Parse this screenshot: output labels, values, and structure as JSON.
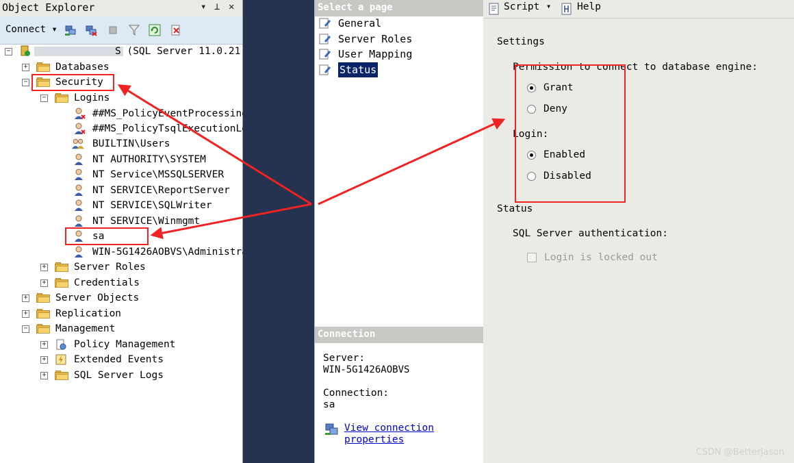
{
  "object_explorer": {
    "title": "Object Explorer",
    "pin": "∇ ↑",
    "close": "✕",
    "toolbar": {
      "connect_label": "Connect ▾"
    },
    "server": {
      "label": "S  (SQL Server 11.0.21"
    },
    "tree": {
      "databases": "Databases",
      "security": "Security",
      "logins": "Logins",
      "login_items": [
        "##MS_PolicyEventProcessing",
        "##MS_PolicyTsqlExecutionLo",
        "BUILTIN\\Users",
        "NT AUTHORITY\\SYSTEM",
        "NT Service\\MSSQLSERVER",
        "NT SERVICE\\ReportServer",
        "NT SERVICE\\SQLWriter",
        "NT SERVICE\\Winmgmt",
        "sa",
        "WIN-5G1426AOBVS\\Administra"
      ],
      "server_roles": "Server Roles",
      "credentials": "Credentials",
      "server_objects": "Server Objects",
      "replication": "Replication",
      "management": "Management",
      "policy_management": "Policy Management",
      "extended_events": "Extended Events",
      "sql_server_logs": "SQL Server Logs"
    }
  },
  "select_page": {
    "header": "Select a page",
    "items": [
      "General",
      "Server Roles",
      "User Mapping",
      "Status"
    ],
    "selected": "Status"
  },
  "connection": {
    "header": "Connection",
    "server_label": "Server:",
    "server_value": "WIN-5G1426AOBVS",
    "connection_label": "Connection:",
    "connection_value": "sa",
    "view_link_1": "View connection",
    "view_link_2": "properties"
  },
  "toolbar": {
    "script_label": "Script",
    "script_arrow": "▾",
    "help_label": "Help"
  },
  "settings": {
    "section_title": "Settings",
    "permission_label": "Permission to connect to database engine:",
    "grant": "Grant",
    "deny": "Deny",
    "permission_value": "Grant",
    "login_label": "Login:",
    "enabled": "Enabled",
    "disabled": "Disabled",
    "login_value": "Enabled"
  },
  "status": {
    "section_title": "Status",
    "auth_label": "SQL Server authentication:",
    "locked_label": "Login is locked out",
    "locked_checked": false
  },
  "watermark": "CSDN @BetterJason",
  "colors": {
    "selection": "#0a246a",
    "annotation": "#f02222",
    "link": "#0000cc"
  }
}
